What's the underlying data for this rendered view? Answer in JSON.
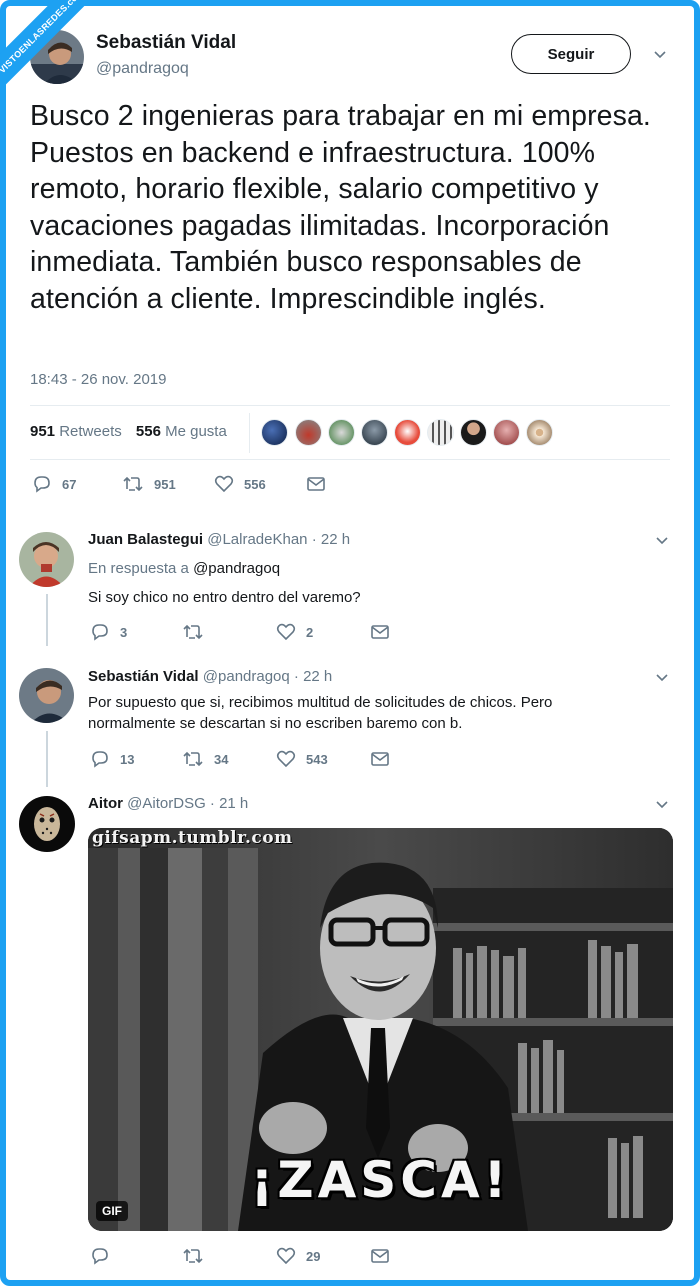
{
  "watermark": "VISTOENLASREDES.com",
  "main_tweet": {
    "name": "Sebastián Vidal",
    "handle": "@pandragoq",
    "follow_label": "Seguir",
    "text": "Busco 2 ingenieras para trabajar en mi empresa. Puestos en backend e infraestructura. 100% remoto, horario flexible, salario competitivo y vacaciones pagadas ilimitadas. Incorporación inmediata. También busco responsables de atención a cliente. Imprescindible inglés.",
    "timestamp": "18:43 - 26 nov. 2019",
    "retweets_count": "951",
    "retweets_label": "Retweets",
    "likes_count": "556",
    "likes_label": "Me gusta",
    "actions": {
      "replies": "67",
      "retweets": "951",
      "likes": "556"
    }
  },
  "replies": [
    {
      "name": "Juan Balastegui",
      "handle": "@LalradeKhan",
      "time": "· 22 h",
      "in_reply_prefix": "En respuesta a",
      "in_reply_to": "@pandragoq",
      "text": "Si soy chico no entro dentro del varemo?",
      "actions": {
        "replies": "3",
        "retweets": "",
        "likes": "2"
      }
    },
    {
      "name": "Sebastián Vidal",
      "handle": "@pandragoq",
      "time": "· 22 h",
      "text": "Por supuesto que si, recibimos multitud de solicitudes de chicos. Pero normalmente se descartan si no escriben baremo con b.",
      "actions": {
        "replies": "13",
        "retweets": "34",
        "likes": "543"
      }
    },
    {
      "name": "Aitor",
      "handle": "@AitorDSG",
      "time": "· 21 h",
      "media": {
        "watermark": "gifsapm.tumblr.com",
        "caption": "¡ZASCA!",
        "badge": "GIF"
      },
      "actions": {
        "replies": "",
        "retweets": "",
        "likes": "29"
      }
    }
  ]
}
